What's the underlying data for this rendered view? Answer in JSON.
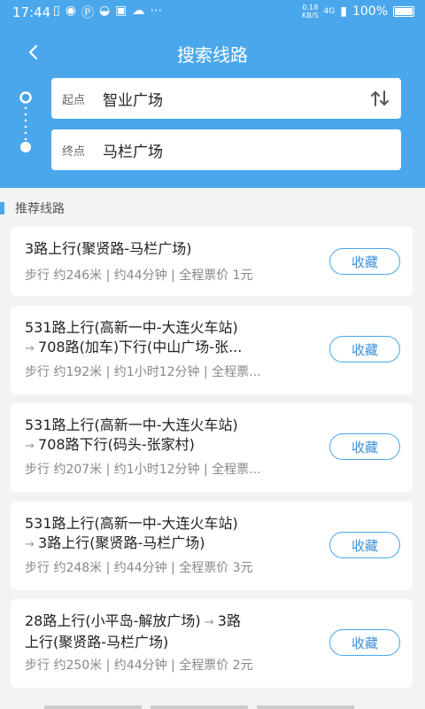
{
  "status_bar": {
    "time": "17:44",
    "speed_value": "0.18",
    "speed_unit": "KB/S",
    "network": "4G",
    "battery": "100%"
  },
  "header": {
    "title": "搜索线路"
  },
  "search": {
    "start_label": "起点",
    "start_value": "智业广场",
    "end_label": "终点",
    "end_value": "马栏广场"
  },
  "section": {
    "title": "推荐线路"
  },
  "routes": [
    {
      "line1": "3路上行(聚贤路-马栏广场)",
      "line2": "",
      "meta": "步行 约246米 | 约44分钟 | 全程票价 1元",
      "fav": "收藏"
    },
    {
      "line1": "531路上行(高新一中-大连火车站)",
      "line2": "708路(加车)下行(中山广场-张...",
      "meta": "步行 约192米 | 约1小时12分钟 | 全程票...",
      "fav": "收藏"
    },
    {
      "line1": "531路上行(高新一中-大连火车站)",
      "line2": "708路下行(码头-张家村)",
      "meta": "步行 约207米 | 约1小时12分钟 | 全程票...",
      "fav": "收藏"
    },
    {
      "line1": "531路上行(高新一中-大连火车站)",
      "line2": "3路上行(聚贤路-马栏广场)",
      "meta": "步行 约248米 | 约44分钟 | 全程票价 3元",
      "fav": "收藏"
    },
    {
      "line1": "28路上行(小平岛-解放广场)",
      "line1_cont": "3路",
      "line2": "上行(聚贤路-马栏广场)",
      "meta": "步行 约250米 | 约44分钟 | 全程票价 2元",
      "fav": "收藏"
    }
  ],
  "colors": {
    "primary": "#4aa7ec",
    "background": "#f2f3f5",
    "card": "#ffffff"
  }
}
